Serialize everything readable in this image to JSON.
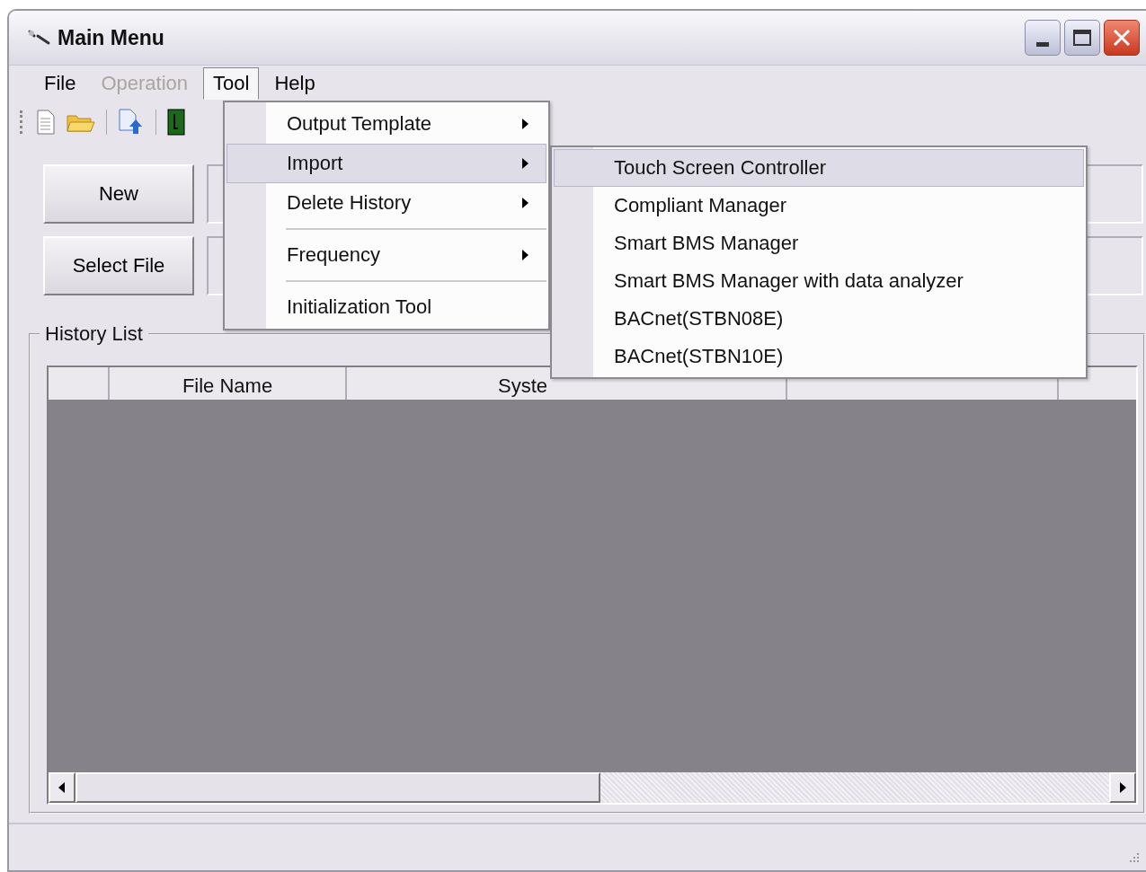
{
  "window": {
    "title": "Main Menu"
  },
  "menu_bar": [
    {
      "label": "File",
      "disabled": false,
      "selected": false
    },
    {
      "label": "Operation",
      "disabled": true,
      "selected": false
    },
    {
      "label": "Tool",
      "disabled": false,
      "selected": true
    },
    {
      "label": "Help",
      "disabled": false,
      "selected": false
    }
  ],
  "buttons": [
    "New",
    "Select File"
  ],
  "history_list": {
    "title": "History List",
    "columns": [
      "File Name",
      "Syste"
    ]
  },
  "tool_menu": [
    {
      "kind": "item",
      "label": "Output Template",
      "submenu": true,
      "selected": false
    },
    {
      "kind": "item",
      "label": "Import",
      "submenu": true,
      "selected": true
    },
    {
      "kind": "item",
      "label": "Delete History",
      "submenu": true,
      "selected": false
    },
    {
      "kind": "separator"
    },
    {
      "kind": "item",
      "label": "Frequency",
      "submenu": true,
      "selected": false
    },
    {
      "kind": "separator"
    },
    {
      "kind": "item",
      "label": "Initialization Tool",
      "submenu": false,
      "selected": false
    }
  ],
  "import_submenu": [
    {
      "label": "Touch Screen Controller",
      "selected": true
    },
    {
      "label": "Compliant Manager",
      "selected": false
    },
    {
      "label": "Smart BMS Manager",
      "selected": false
    },
    {
      "label": "Smart BMS Manager with data analyzer",
      "selected": false
    },
    {
      "label": "BACnet(STBN08E)",
      "selected": false
    },
    {
      "label": "BACnet(STBN10E)",
      "selected": false
    }
  ]
}
